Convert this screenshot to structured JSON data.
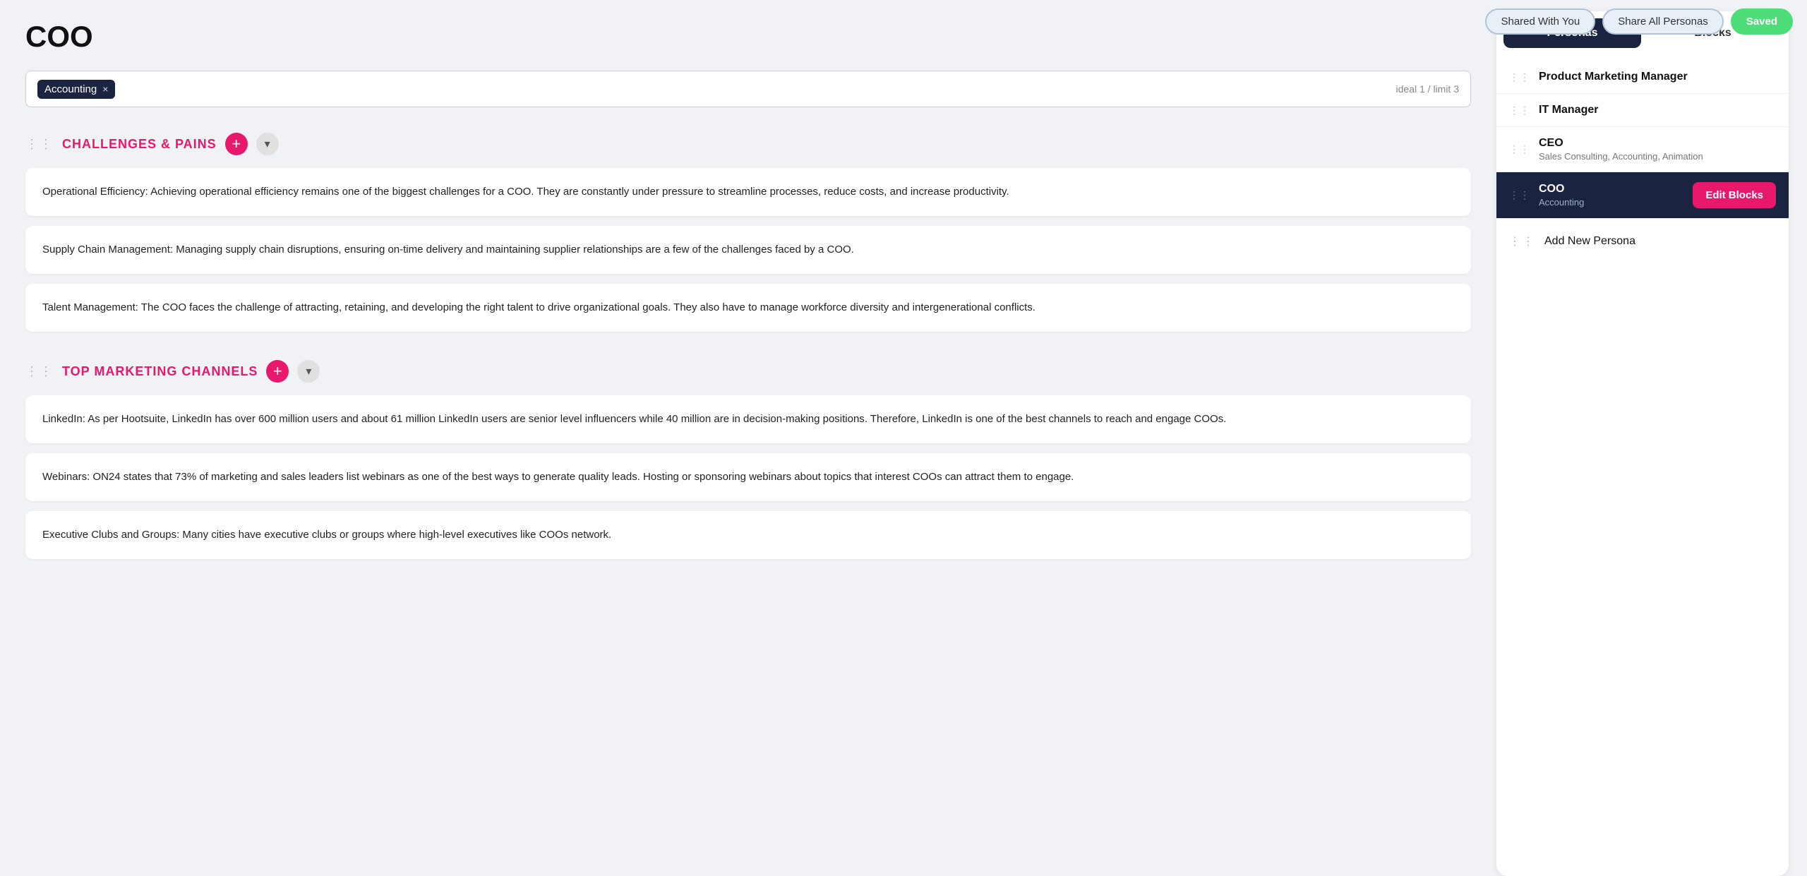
{
  "topBar": {
    "sharedWithYou": "Shared With You",
    "shareAllPersonas": "Share All Personas",
    "saved": "Saved"
  },
  "page": {
    "title": "COO"
  },
  "tagInput": {
    "tag": "Accounting",
    "hint": "ideal 1 / limit 3"
  },
  "sections": [
    {
      "id": "challenges",
      "title": "CHALLENGES & PAINS",
      "cards": [
        "Operational Efficiency: Achieving operational efficiency remains one of the biggest challenges for a COO. They are constantly under pressure to streamline processes, reduce costs, and increase productivity.",
        "Supply Chain Management: Managing supply chain disruptions, ensuring on-time delivery and maintaining supplier relationships are a few of the challenges faced by a COO.",
        "Talent Management: The COO faces the challenge of attracting, retaining, and developing the right talent to drive organizational goals. They also have to manage workforce diversity and intergenerational conflicts."
      ]
    },
    {
      "id": "marketing-channels",
      "title": "TOP MARKETING CHANNELS",
      "cards": [
        "LinkedIn: As per Hootsuite, LinkedIn has over 600 million users and about 61 million LinkedIn users are senior level influencers while 40 million are in decision-making positions. Therefore, LinkedIn is one of the best channels to reach and engage COOs.",
        "Webinars: ON24 states that 73% of marketing and sales leaders list webinars as one of the best ways to generate quality leads. Hosting or sponsoring webinars about topics that interest COOs can attract them to engage.",
        "Executive Clubs and Groups: Many cities have executive clubs or groups where high-level executives like COOs network."
      ]
    }
  ],
  "rightPanel": {
    "tabs": [
      {
        "id": "personas",
        "label": "Personas",
        "active": true
      },
      {
        "id": "blocks",
        "label": "Blocks",
        "active": false
      }
    ],
    "personas": [
      {
        "id": "product-marketing-manager",
        "name": "Product Marketing Manager",
        "sub": "",
        "active": false
      },
      {
        "id": "it-manager",
        "name": "IT Manager",
        "sub": "",
        "active": false
      },
      {
        "id": "ceo",
        "name": "CEO",
        "sub": "Sales Consulting, Accounting, Animation",
        "active": false
      },
      {
        "id": "coo",
        "name": "COO",
        "sub": "Accounting",
        "active": true
      }
    ],
    "addPersonaLabel": "Add New Persona",
    "editBlocksLabel": "Edit Blocks"
  }
}
